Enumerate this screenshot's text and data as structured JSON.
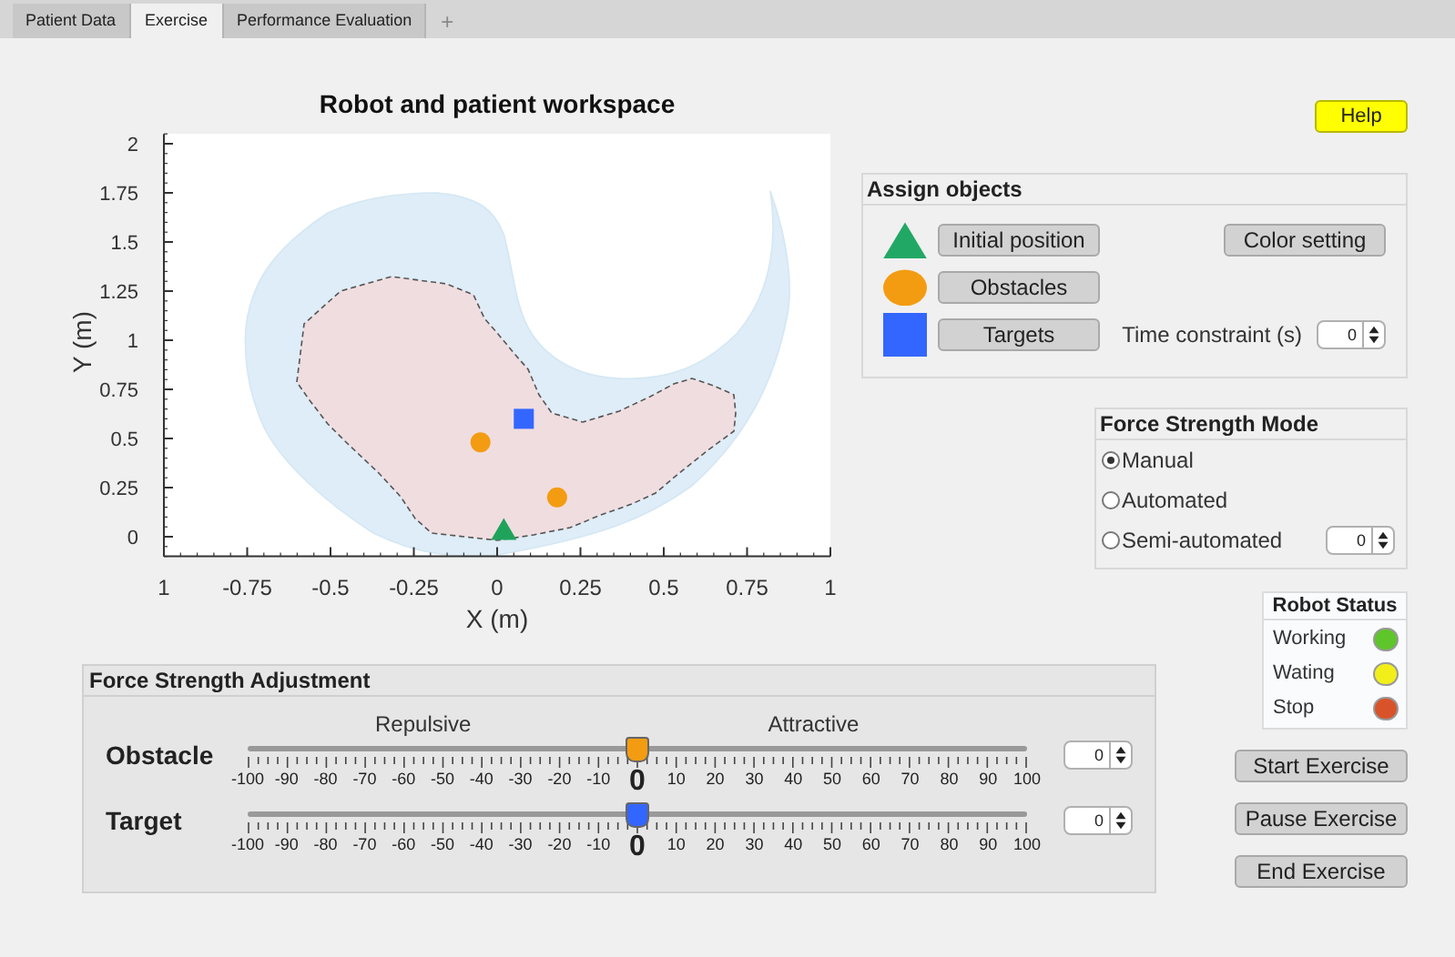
{
  "tabs": [
    {
      "label": "Patient Data",
      "selected": false
    },
    {
      "label": "Exercise",
      "selected": true
    },
    {
      "label": "Performance Evaluation",
      "selected": false
    }
  ],
  "add_tab": "+",
  "help_button": "Help",
  "workspace_plot": {
    "chart_data": {
      "type": "scatter",
      "title": "Robot and patient workspace",
      "xlabel": "X (m)",
      "ylabel": "Y (m)",
      "xlim": [
        -1,
        1
      ],
      "ylim": [
        -0.1,
        2.05
      ],
      "xticks": [
        {
          "value": -1,
          "label": "1"
        },
        -0.75,
        -0.5,
        -0.25,
        0,
        0.25,
        0.5,
        0.75,
        1
      ],
      "yticks": [
        0,
        0.25,
        0.5,
        0.75,
        1,
        1.25,
        1.5,
        1.75,
        2
      ],
      "series": [
        {
          "color": "#1fa35a",
          "x": [
            0.02
          ],
          "values": [
            0.03
          ]
        },
        {
          "color": "#f39c12",
          "x": [
            -0.05,
            0.18
          ],
          "values": [
            0.48,
            0.2
          ]
        },
        {
          "color": "#3366ff",
          "x": [
            0.08
          ],
          "values": [
            0.6
          ]
        }
      ]
    }
  },
  "assign_objects": {
    "title": "Assign objects",
    "objects": [
      {
        "kind": "triangle",
        "color": "#22a865",
        "button": "Initial position"
      },
      {
        "kind": "circle",
        "color": "#f39c12",
        "button": "Obstacles"
      },
      {
        "kind": "square",
        "color": "#3366ff",
        "button": "Targets"
      }
    ],
    "color_setting_button": "Color setting",
    "time_constraint": {
      "label": "Time constraint (s)",
      "value": "0"
    }
  },
  "force_strength_mode": {
    "title": "Force Strength Mode",
    "options": [
      {
        "label": "Manual",
        "selected": true
      },
      {
        "label": "Automated",
        "selected": false
      },
      {
        "label": "Semi-automated",
        "selected": false,
        "value": "0"
      }
    ]
  },
  "force_strength_adjustment": {
    "title": "Force Strength Adjustment",
    "left_label": "Repulsive",
    "right_label": "Attractive",
    "sliders": [
      {
        "label": "Obstacle",
        "color": "#f39c12",
        "level": 0.5,
        "value": "0",
        "scale_labels": [
          "-100",
          "-90",
          "-80",
          "-70",
          "-60",
          "-50",
          "-40",
          "-30",
          "-20",
          "-10",
          "0",
          "10",
          "20",
          "30",
          "40",
          "50",
          "60",
          "70",
          "80",
          "90",
          "100"
        ]
      },
      {
        "label": "Target",
        "color": "#3366ff",
        "level": 0.5,
        "value": "0",
        "scale_labels": [
          "-100",
          "-90",
          "-80",
          "-70",
          "-60",
          "-50",
          "-40",
          "-30",
          "-20",
          "-10",
          "0",
          "10",
          "20",
          "30",
          "40",
          "50",
          "60",
          "70",
          "80",
          "90",
          "100"
        ]
      }
    ]
  },
  "robot_status": {
    "title": "Robot Status",
    "items": [
      {
        "label": "Working",
        "color": "#5ec52a"
      },
      {
        "label": "Wating",
        "color": "#f2ee1a"
      },
      {
        "label": "Stop",
        "color": "#d9532a"
      }
    ]
  },
  "buttons": [
    "Start Exercise",
    "Pause Exercise",
    "End Exercise"
  ]
}
